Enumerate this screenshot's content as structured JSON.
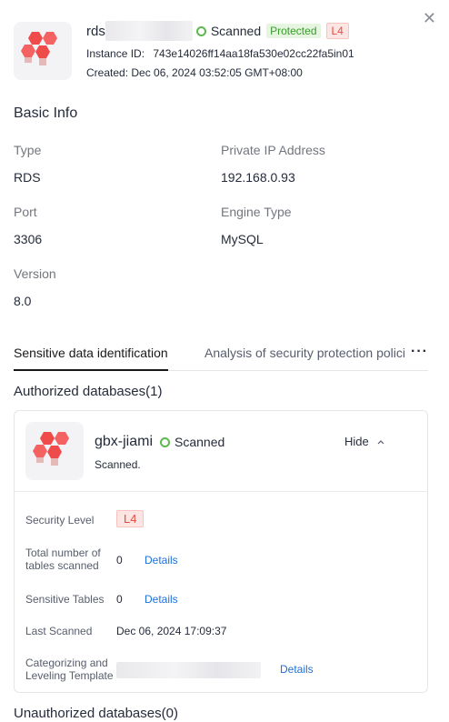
{
  "header": {
    "title_prefix": "rds",
    "status": "Scanned",
    "protected_tag": "Protected",
    "level_tag": "L4",
    "instance_id_label": "Instance ID:",
    "instance_id": "743e14026ff14aa18fa530e02cc22fa5in01",
    "created": "Created: Dec 06, 2024 03:52:05 GMT+08:00"
  },
  "basic_info": {
    "title": "Basic Info",
    "type_label": "Type",
    "type_value": "RDS",
    "private_ip_label": "Private IP Address",
    "private_ip_value": "192.168.0.93",
    "port_label": "Port",
    "port_value": "3306",
    "engine_label": "Engine Type",
    "engine_value": "MySQL",
    "version_label": "Version",
    "version_value": "8.0"
  },
  "tabs": {
    "items": [
      {
        "label": "Sensitive data identification"
      },
      {
        "label": "Analysis of security protection polici"
      }
    ],
    "more": "···"
  },
  "authorized": {
    "title": "Authorized databases(1)",
    "card": {
      "name": "gbx-jiami",
      "status": "Scanned",
      "hide_label": "Hide",
      "scan_note": "Scanned.",
      "security_level_label": "Security Level",
      "security_level_value": "L4",
      "tables_scanned_label": "Total number of tables scanned",
      "tables_scanned_value": "0",
      "sensitive_tables_label": "Sensitive Tables",
      "sensitive_tables_value": "0",
      "last_scanned_label": "Last Scanned",
      "last_scanned_value": "Dec 06, 2024 17:09:37",
      "template_label": "Categorizing and Leveling Template",
      "details_label": "Details"
    }
  },
  "unauthorized": {
    "title": "Unauthorized databases(0)"
  },
  "icons": [
    "rds-logo-icon",
    "status-scanned-icon",
    "close-icon",
    "more-icon",
    "chevron-up-icon",
    "database-logo-icon"
  ],
  "colors": {
    "scanned_green": "#5eb84f",
    "protected_bg": "#e5f5df",
    "level_red": "#e54d42",
    "link_blue": "#1e6fd9"
  }
}
